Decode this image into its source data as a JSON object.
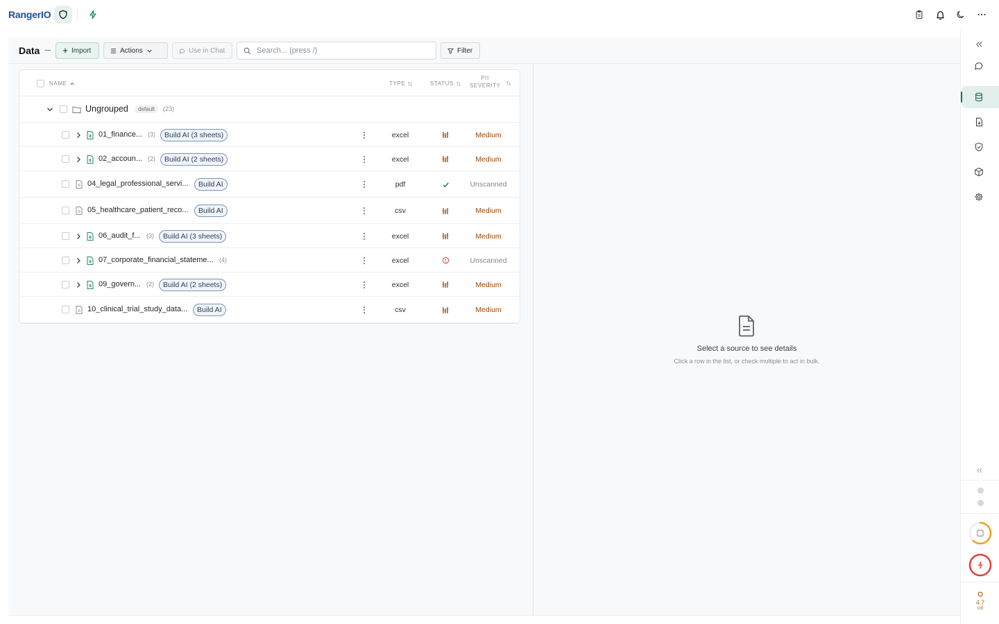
{
  "app": {
    "brand": "RangerIO"
  },
  "toolbar": {
    "title": "Data",
    "import_label": "Import",
    "actions_label": "Actions",
    "use_in_chat_label": "Use in Chat",
    "search_placeholder": "Search... (press /)",
    "filter_label": "Filter"
  },
  "table": {
    "columns": {
      "name": "NAME",
      "type": "TYPE",
      "status": "STATUS",
      "pii_line1": "PII",
      "pii_line2": "SEVERITY"
    },
    "group": {
      "name": "Ungrouped",
      "badge": "default",
      "count": "(23)"
    },
    "rows": [
      {
        "name": "01_finance...",
        "count": "(3)",
        "tag": "Build AI (3 sheets)",
        "type": "excel",
        "status": "scanning",
        "severity": "Medium",
        "expandable": true,
        "kind": "sheet"
      },
      {
        "name": "02_accoun...",
        "count": "(2)",
        "tag": "Build AI (2 sheets)",
        "type": "excel",
        "status": "scanning",
        "severity": "Medium",
        "expandable": true,
        "kind": "sheet"
      },
      {
        "name": "04_legal_professional_servi...",
        "count": "",
        "tag": "Build AI",
        "type": "pdf",
        "status": "done",
        "severity": "Unscanned",
        "expandable": false,
        "kind": "doc"
      },
      {
        "name": "05_healthcare_patient_reco...",
        "count": "",
        "tag": "Build AI",
        "type": "csv",
        "status": "scanning",
        "severity": "Medium",
        "expandable": false,
        "kind": "doc"
      },
      {
        "name": "06_audit_f...",
        "count": "(3)",
        "tag": "Build AI (3 sheets)",
        "type": "excel",
        "status": "scanning",
        "severity": "Medium",
        "expandable": true,
        "kind": "sheet"
      },
      {
        "name": "07_corporate_financial_stateme...",
        "count": "(4)",
        "tag": "",
        "type": "excel",
        "status": "error",
        "severity": "Unscanned",
        "expandable": true,
        "kind": "sheet"
      },
      {
        "name": "09_govern...",
        "count": "(2)",
        "tag": "Build AI (2 sheets)",
        "type": "excel",
        "status": "scanning",
        "severity": "Medium",
        "expandable": true,
        "kind": "sheet"
      },
      {
        "name": "10_clinical_trial_study_data...",
        "count": "",
        "tag": "Build AI",
        "type": "csv",
        "status": "scanning",
        "severity": "Medium",
        "expandable": false,
        "kind": "doc"
      }
    ]
  },
  "details": {
    "title": "Select a source to see details",
    "subtitle": "Click a row in the list, or check multiple to act in bulk."
  },
  "rail": {
    "memory_value": "4.7",
    "memory_unit": "GB",
    "cpu_progress": 0.62,
    "alert_progress": 1.0
  },
  "colors": {
    "brand": "#1e4f8f",
    "accent": "#1d6b5b",
    "severity_medium": "#a04400",
    "status_error": "#d23b3b",
    "status_done": "#1d7a4f",
    "ring_orange": "#f0a020",
    "ring_red": "#e0413c"
  }
}
